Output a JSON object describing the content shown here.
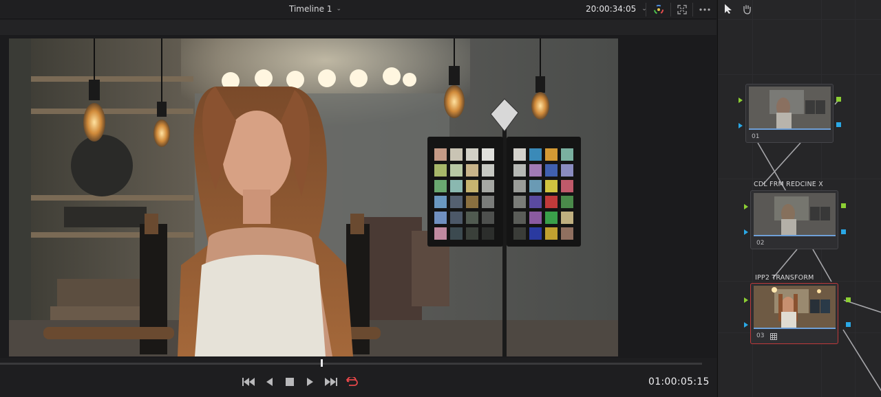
{
  "toolbar": {
    "timeline_name": "Timeline 1",
    "source_timecode": "20:00:34:05",
    "icons": [
      "chevron-down-icon",
      "color-wheel-icon",
      "fullscreen-icon",
      "more-options-icon",
      "pointer-icon",
      "hand-icon"
    ]
  },
  "transport": {
    "record_timecode": "01:00:05:15",
    "playhead_fraction": 0.457,
    "loop_active_color": "#e8484a",
    "buttons": [
      "jump-to-start",
      "step-back",
      "stop",
      "play",
      "jump-to-end",
      "loop"
    ]
  },
  "nodes": [
    {
      "number": "01",
      "label": ""
    },
    {
      "number": "02",
      "label": "CDL FRM REDCINE X"
    },
    {
      "number": "03",
      "label": "IPP2 TRANSFORM",
      "active": true
    }
  ],
  "colors": {
    "accent_red": "#c0393b",
    "port_green": "#8ccf34",
    "port_blue": "#2aa8e6",
    "node_bar": "#6fa0d8"
  }
}
